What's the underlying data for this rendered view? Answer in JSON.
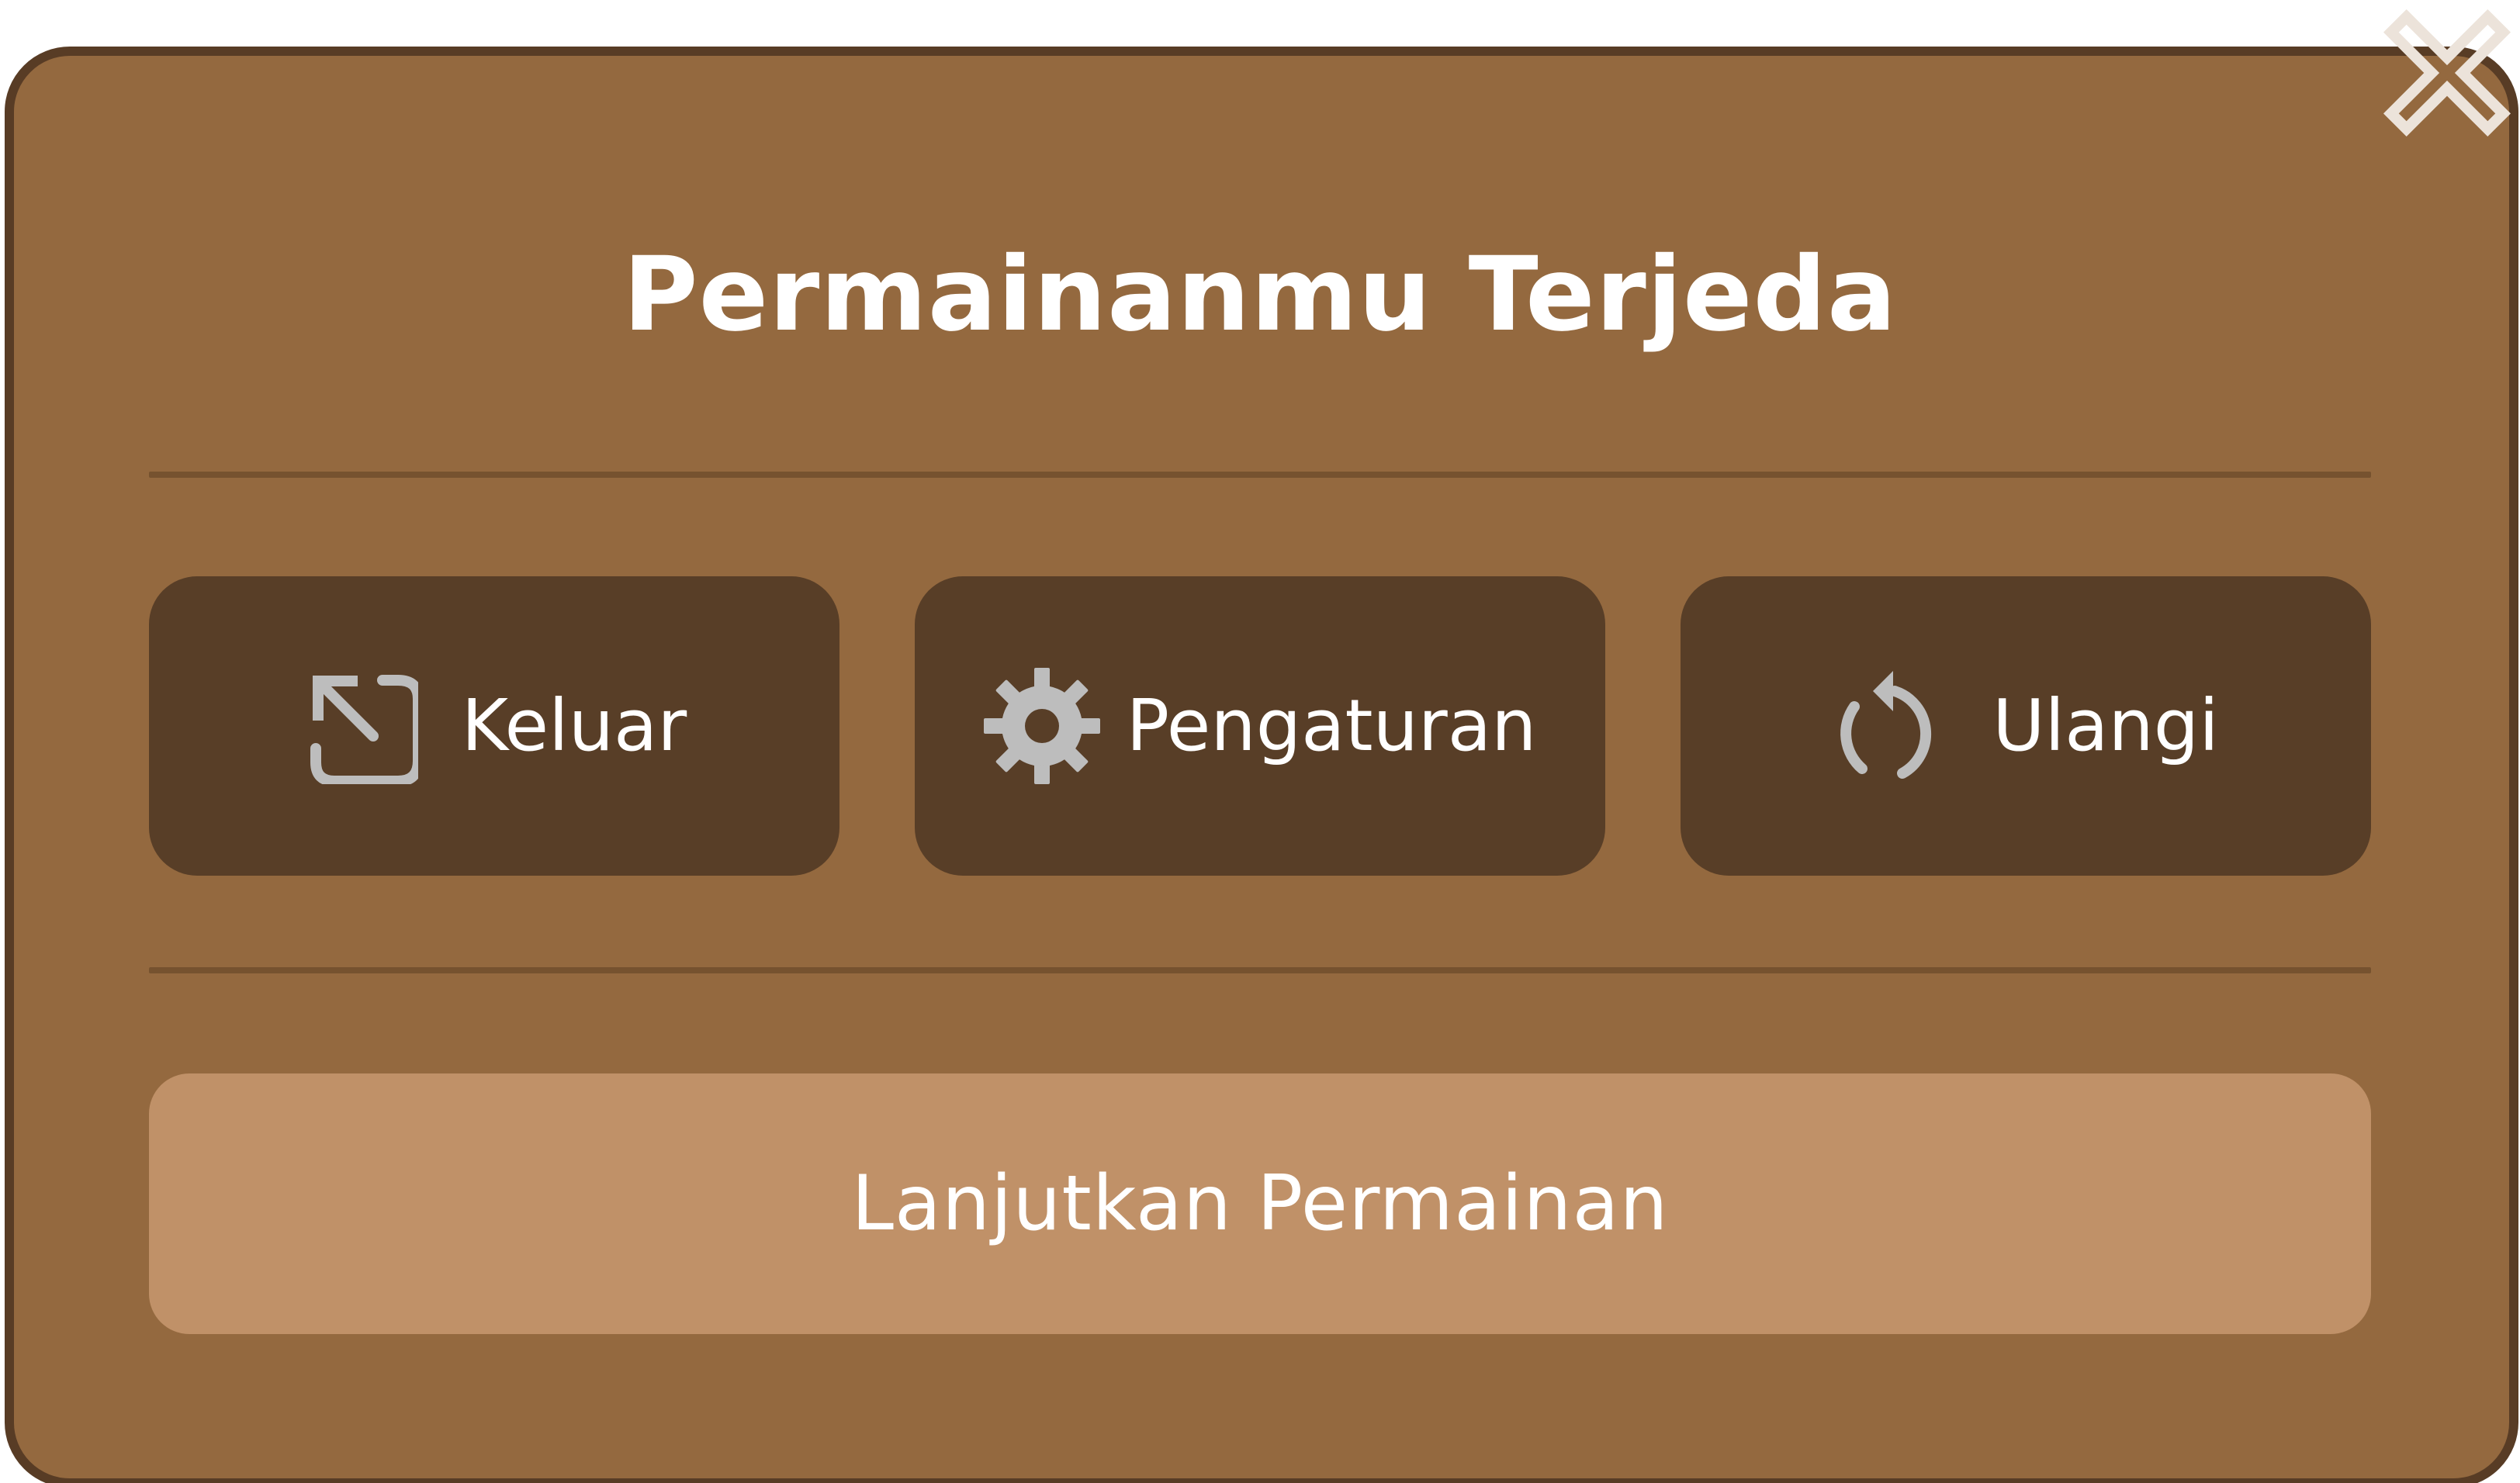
{
  "dialog": {
    "title": "Permainanmu Terjeda",
    "close_icon": "close-x-icon"
  },
  "actions": [
    {
      "id": "exit",
      "label": "Keluar",
      "icon": "exit-arrow-icon"
    },
    {
      "id": "settings",
      "label": "Pengaturan",
      "icon": "gear-icon"
    },
    {
      "id": "restart",
      "label": "Ulangi",
      "icon": "restart-icon"
    }
  ],
  "resume": {
    "label": "Lanjutkan Permainan"
  },
  "colors": {
    "panel": "#94693f",
    "panel_border": "#583c25",
    "action_button": "#583e27",
    "resume_button": "#c09168",
    "icon": "#bdbdbd",
    "close_icon": "#ece3da",
    "text": "#ffffff"
  }
}
